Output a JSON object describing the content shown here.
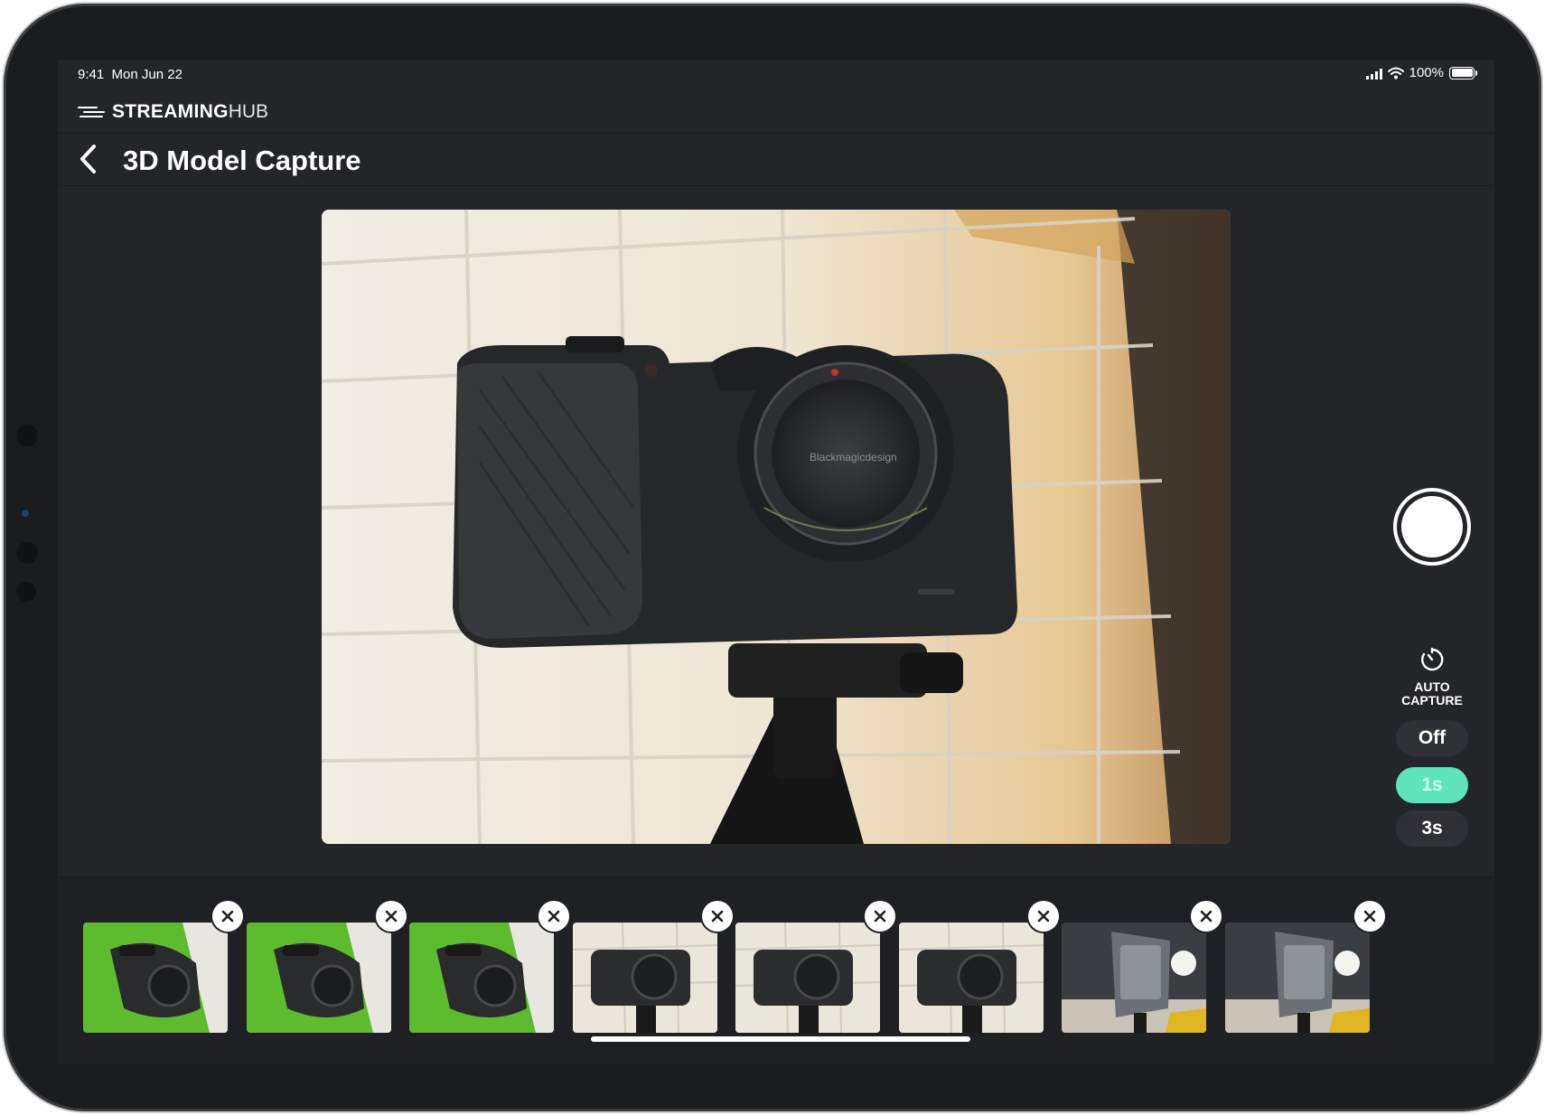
{
  "status": {
    "time": "9:41",
    "date": "Mon Jun 22",
    "battery": "100%"
  },
  "brand": {
    "strong": "STREAMING",
    "light": "HUB"
  },
  "header": {
    "title": "3D Model Capture"
  },
  "auto_capture": {
    "label_line1": "AUTO",
    "label_line2": "CAPTURE",
    "options": [
      "Off",
      "1s",
      "3s"
    ],
    "selected": "1s"
  },
  "thumbnails": [
    {
      "scene": "green-screen"
    },
    {
      "scene": "green-screen"
    },
    {
      "scene": "green-screen"
    },
    {
      "scene": "tile-wall"
    },
    {
      "scene": "tile-wall"
    },
    {
      "scene": "tile-wall"
    },
    {
      "scene": "studio"
    },
    {
      "scene": "studio"
    }
  ],
  "colors": {
    "accent": "#5ee3ba",
    "background": "#242529",
    "filmstrip": "#1f2023"
  }
}
